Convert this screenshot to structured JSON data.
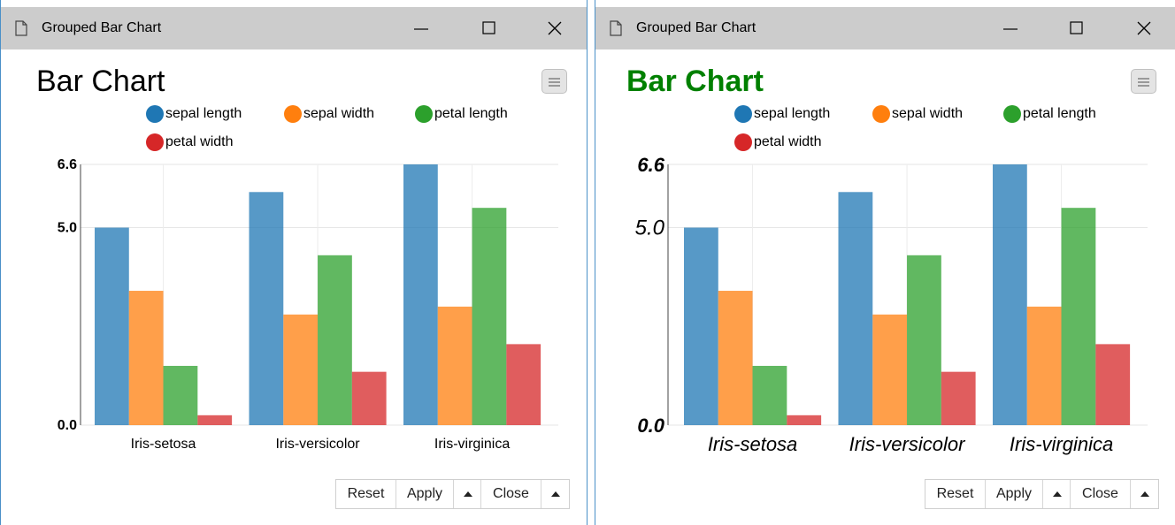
{
  "windows": [
    {
      "title": "Grouped Bar Chart",
      "chart_title": "Bar Chart",
      "buttons": {
        "reset": "Reset",
        "apply": "Apply",
        "close": "Close"
      }
    },
    {
      "title": "Grouped Bar Chart",
      "chart_title": "Bar Chart",
      "buttons": {
        "reset": "Reset",
        "apply": "Apply",
        "close": "Close"
      }
    }
  ],
  "colors": {
    "sepal_length": "#1f77b4",
    "sepal_width": "#ff7f0e",
    "petal_length": "#2ca02c",
    "petal_width": "#d62728",
    "right_title": "#008000"
  },
  "icons": [
    "document-icon",
    "minimize-icon",
    "maximize-icon",
    "close-icon",
    "menu-icon"
  ],
  "chart_data": [
    {
      "type": "bar",
      "title": "Bar Chart",
      "categories": [
        "Iris-setosa",
        "Iris-versicolor",
        "Iris-virginica"
      ],
      "series": [
        {
          "name": "sepal length",
          "values": [
            5.0,
            5.9,
            6.6
          ]
        },
        {
          "name": "sepal width",
          "values": [
            3.4,
            2.8,
            3.0
          ]
        },
        {
          "name": "petal length",
          "values": [
            1.5,
            4.3,
            5.5
          ]
        },
        {
          "name": "petal width",
          "values": [
            0.25,
            1.35,
            2.05
          ]
        }
      ],
      "y_ticks": [
        "0.0",
        "5.0",
        "6.6"
      ],
      "ylim": [
        0,
        6.6
      ],
      "xlabel": "",
      "ylabel": "",
      "legend": "top",
      "grid": true
    },
    {
      "type": "bar",
      "title": "Bar Chart",
      "categories": [
        "Iris-setosa",
        "Iris-versicolor",
        "Iris-virginica"
      ],
      "series": [
        {
          "name": "sepal length",
          "values": [
            5.0,
            5.9,
            6.6
          ]
        },
        {
          "name": "sepal width",
          "values": [
            3.4,
            2.8,
            3.0
          ]
        },
        {
          "name": "petal length",
          "values": [
            1.5,
            4.3,
            5.5
          ]
        },
        {
          "name": "petal width",
          "values": [
            0.25,
            1.35,
            2.05
          ]
        }
      ],
      "y_ticks": [
        "0.0",
        "5.0",
        "6.6"
      ],
      "ylim": [
        0,
        6.6
      ],
      "xlabel": "",
      "ylabel": "",
      "legend": "top",
      "grid": true
    }
  ]
}
